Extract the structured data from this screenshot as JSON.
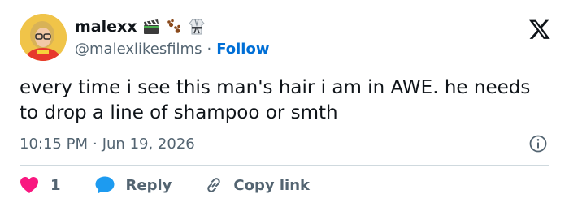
{
  "author": {
    "display_name": "malexx",
    "handle": "@malexlikesfilms",
    "badges": [
      "clapper-board-emoji",
      "paw-prints-emoji",
      "martial-arts-uniform-emoji"
    ]
  },
  "follow_label": "Follow",
  "separator": "·",
  "tweet": {
    "text": "every time i see this man's hair i am in AWE. he needs to drop a line of shampoo or smth",
    "time": "10:15 PM",
    "date": "Jun 19, 2026"
  },
  "actions": {
    "like_count": "1",
    "reply_label": "Reply",
    "copy_link_label": "Copy link"
  },
  "colors": {
    "like": "#f91880",
    "reply": "#1d9bf0",
    "link": "#006fd6",
    "muted": "#536471"
  },
  "icons": {
    "logo": "x-logo-icon",
    "info": "info-icon",
    "like": "heart-icon",
    "reply": "speech-bubble-icon",
    "copy": "link-icon"
  }
}
